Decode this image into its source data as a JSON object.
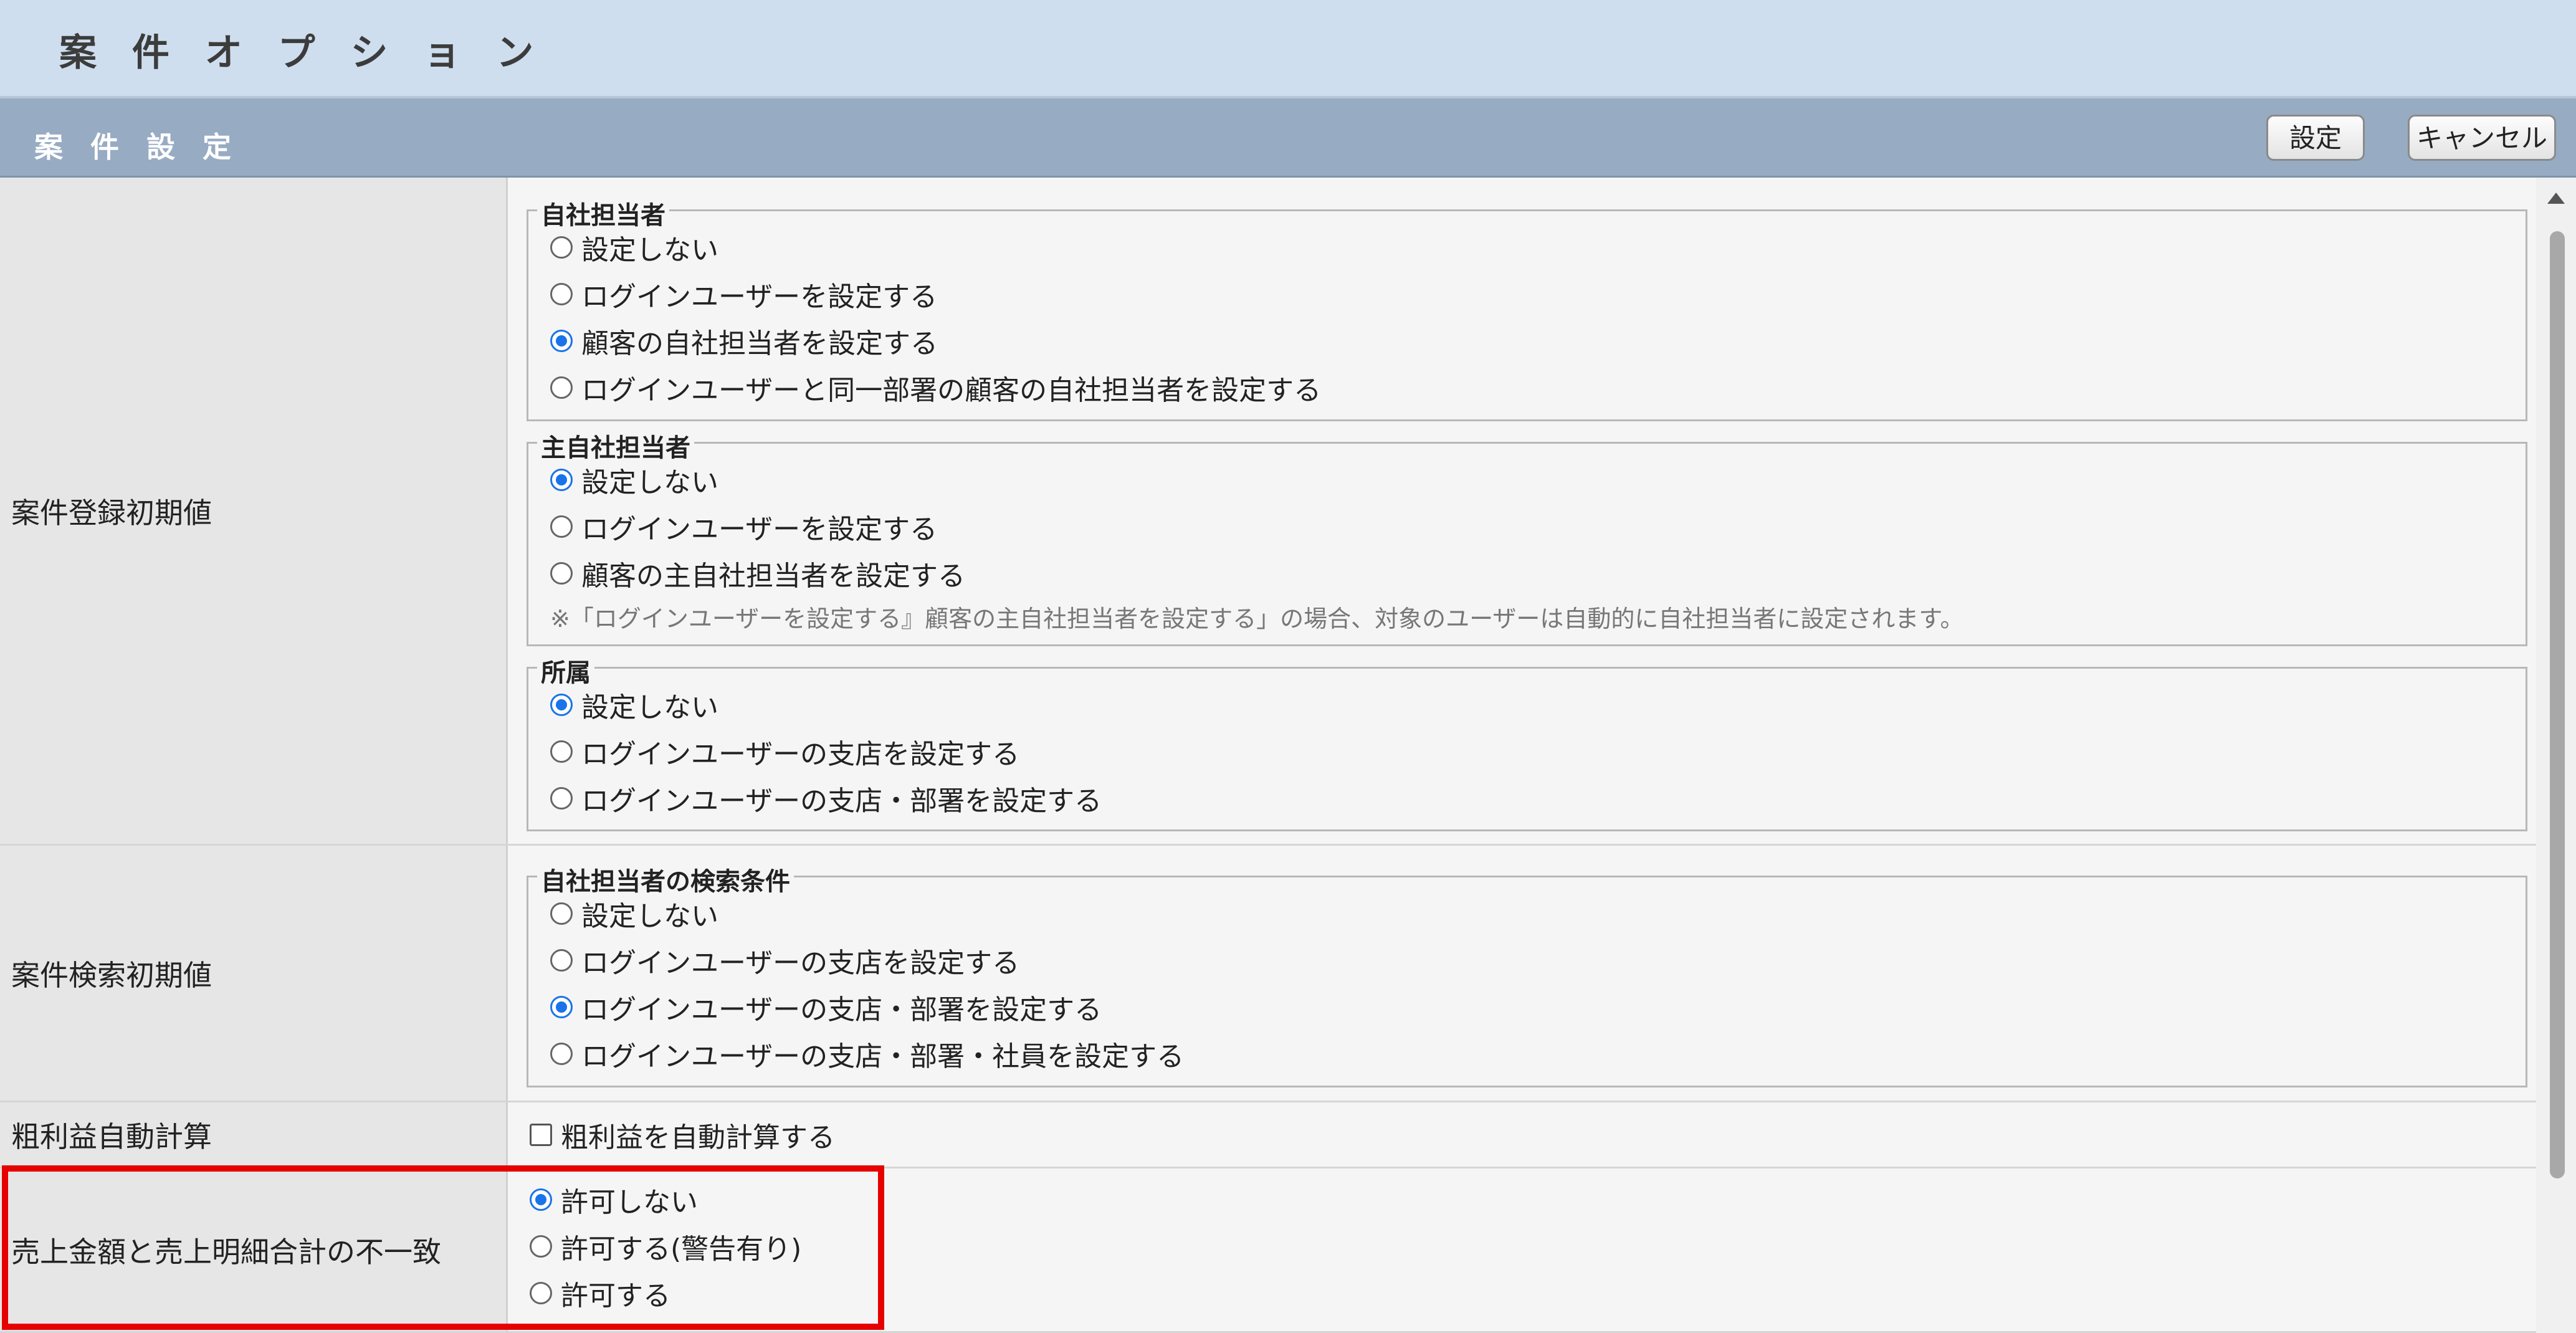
{
  "header": {
    "title": "案 件 オ プ シ ョ ン"
  },
  "section": {
    "title": "案 件 設 定",
    "set_label": "設定",
    "cancel_label": "キャンセル"
  },
  "rows": {
    "register": {
      "label": "案件登録初期値",
      "groups": [
        {
          "title": "自社担当者",
          "options": [
            {
              "label": "設定しない",
              "checked": false
            },
            {
              "label": "ログインユーザーを設定する",
              "checked": false
            },
            {
              "label": "顧客の自社担当者を設定する",
              "checked": true
            },
            {
              "label": "ログインユーザーと同一部署の顧客の自社担当者を設定する",
              "checked": false
            }
          ]
        },
        {
          "title": "主自社担当者",
          "options": [
            {
              "label": "設定しない",
              "checked": true
            },
            {
              "label": "ログインユーザーを設定する",
              "checked": false
            },
            {
              "label": "顧客の主自社担当者を設定する",
              "checked": false
            }
          ],
          "note": "※「ログインユーザーを設定する』顧客の主自社担当者を設定する」の場合、対象のユーザーは自動的に自社担当者に設定されます。"
        },
        {
          "title": "所属",
          "options": [
            {
              "label": "設定しない",
              "checked": true
            },
            {
              "label": "ログインユーザーの支店を設定する",
              "checked": false
            },
            {
              "label": "ログインユーザーの支店・部署を設定する",
              "checked": false
            }
          ]
        }
      ]
    },
    "search": {
      "label": "案件検索初期値",
      "groups": [
        {
          "title": "自社担当者の検索条件",
          "options": [
            {
              "label": "設定しない",
              "checked": false
            },
            {
              "label": "ログインユーザーの支店を設定する",
              "checked": false
            },
            {
              "label": "ログインユーザーの支店・部署を設定する",
              "checked": true
            },
            {
              "label": "ログインユーザーの支店・部署・社員を設定する",
              "checked": false
            }
          ]
        }
      ]
    },
    "profit": {
      "label": "粗利益自動計算",
      "checkbox_label": "粗利益を自動計算する",
      "checked": false
    },
    "mismatch": {
      "label": "売上金額と売上明細合計の不一致",
      "options": [
        {
          "label": "許可しない",
          "checked": true
        },
        {
          "label": "許可する(警告有り)",
          "checked": false
        },
        {
          "label": "許可する",
          "checked": false
        }
      ]
    }
  },
  "colors": {
    "accent": "#1a73e8",
    "highlight": "#e60000",
    "section_bg": "#97abc3",
    "header_bg": "#cfdeee"
  }
}
